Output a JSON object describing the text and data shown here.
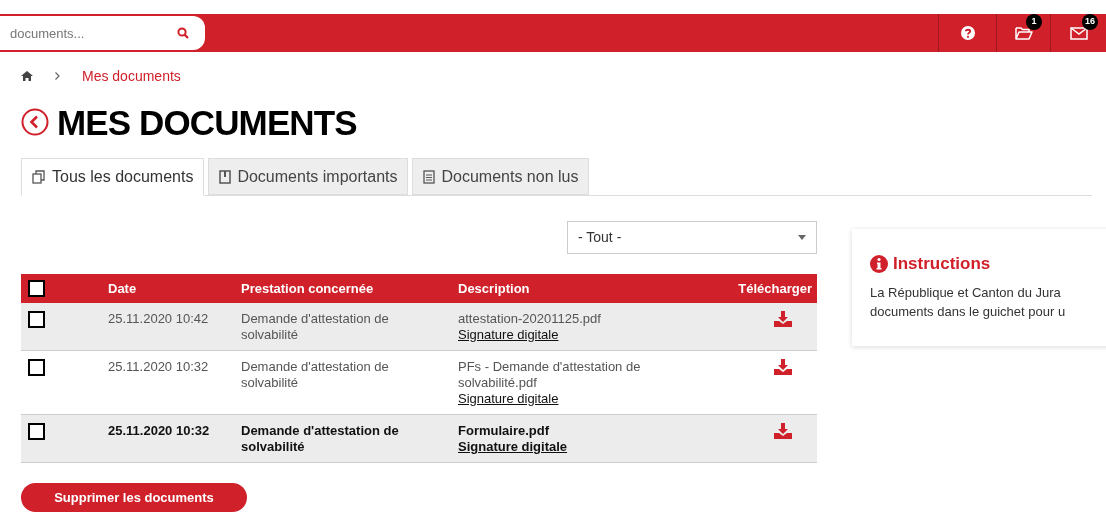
{
  "header": {
    "search": {
      "placeholder": "documents..."
    },
    "icons": [
      {
        "kind": "help"
      },
      {
        "kind": "folder",
        "badge": "1"
      },
      {
        "kind": "mail",
        "badge": "16"
      }
    ]
  },
  "breadcrumb": {
    "current": "Mes documents"
  },
  "title": "MES DOCUMENTS",
  "tabs": [
    {
      "label": "Tous les documents",
      "kind": "all",
      "selected": true
    },
    {
      "label": "Documents importants",
      "kind": "important",
      "selected": false
    },
    {
      "label": "Documents non lus",
      "kind": "unread",
      "selected": false
    }
  ],
  "filter": {
    "value": "- Tout -"
  },
  "table": {
    "select_all": {
      "checked": false
    },
    "columns": [
      "Date",
      "Prestation concernée",
      "Description",
      "Télécharger"
    ],
    "rows": [
      {
        "checked": false,
        "unread": false,
        "date": "25.11.2020 10:42",
        "service": "Demande d'attestation de solvabilité",
        "file": "attestation-20201125.pdf",
        "link": "Signature digitale"
      },
      {
        "checked": false,
        "unread": false,
        "date": "25.11.2020 10:32",
        "service": "Demande d'attestation de solvabilité",
        "file": "PFs - Demande d'attestation de solvabilité.pdf",
        "link": "Signature digitale"
      },
      {
        "checked": false,
        "unread": true,
        "date": "25.11.2020 10:32",
        "service": "Demande d'attestation de solvabilité",
        "file": "Formulaire.pdf",
        "link": "Signature digitale"
      }
    ]
  },
  "delete_button": "Supprimer les documents",
  "instructions": {
    "title": "Instructions",
    "lines": [
      "La République et Canton du Jura",
      "documents dans le guichet pour u"
    ]
  }
}
